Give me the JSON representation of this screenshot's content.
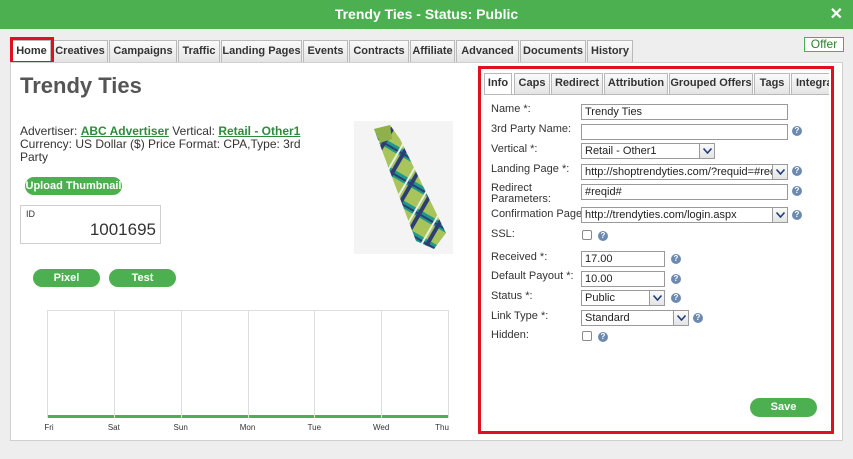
{
  "window": {
    "title": "Trendy Ties - Status: Public",
    "close_glyph": "✕"
  },
  "tabs": [
    "Home",
    "Creatives",
    "Campaigns",
    "Traffic",
    "Landing Pages",
    "Events",
    "Contracts",
    "Affiliate",
    "Advanced",
    "Documents",
    "History"
  ],
  "offer_badge": "Offer",
  "offer": {
    "name": "Trendy Ties",
    "advertiser_label": "Advertiser:",
    "advertiser": "ABC Advertiser",
    "vertical_label": "Vertical:",
    "vertical": "Retail - Other1",
    "currency_text": "Currency: US Dollar ($) Price Format: CPA,Type: 3rd Party",
    "upload_thumbnail": "Upload Thumbnail",
    "id_label": "ID",
    "id_value": "1001695",
    "pixel_button": "Pixel",
    "test_button": "Test"
  },
  "chart_data": {
    "type": "line",
    "categories": [
      "Fri",
      "Sat",
      "Sun",
      "Mon",
      "Tue",
      "Wed",
      "Thu"
    ],
    "values": [
      0,
      0,
      0,
      0,
      0,
      0,
      0
    ],
    "grid": true
  },
  "info_tabs": [
    "Info",
    "Caps",
    "Redirect",
    "Attribution",
    "Grouped Offers",
    "Tags",
    "Integrat"
  ],
  "form": {
    "name_label": "Name *:",
    "name_value": "Trendy Ties",
    "third_party_label": "3rd Party Name:",
    "third_party_value": "",
    "vertical_label": "Vertical *:",
    "vertical_value": "Retail - Other1",
    "landing_label": "Landing Page *:",
    "landing_value": "http://shoptrendyties.com/?requid=#reqid",
    "redirect_label_1": "Redirect",
    "redirect_label_2": "Parameters:",
    "redirect_value": "#reqid#",
    "confirmation_label": "Confirmation Page:",
    "confirmation_value": "http://trendyties.com/login.aspx",
    "ssl_label": "SSL:",
    "received_label": "Received *:",
    "received_value": "17.00",
    "payout_label": "Default Payout *:",
    "payout_value": "10.00",
    "status_label": "Status *:",
    "status_value": "Public",
    "link_type_label": "Link Type *:",
    "link_type_value": "Standard",
    "hidden_label": "Hidden:",
    "save_label": "Save",
    "help_glyph": "?"
  },
  "colors": {
    "accent": "#4caf50",
    "highlight": "#e0101e"
  },
  "icons": {
    "close": "close-icon",
    "help": "help-icon",
    "dropdown": "chevron-down-icon"
  }
}
